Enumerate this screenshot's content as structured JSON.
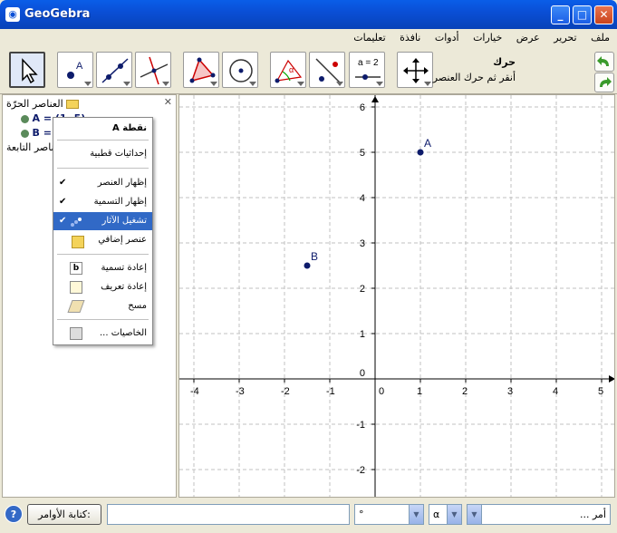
{
  "window": {
    "title": "GeoGebra",
    "minimize": "_",
    "maximize": "□",
    "close": "✕"
  },
  "menu": [
    "ملف",
    "تحرير",
    "عرض",
    "خيارات",
    "أدوات",
    "نافذة",
    "تعليمات"
  ],
  "toolbar": {
    "tool_name": "حرك",
    "tool_hint": "أنقر ثم حرك العنصر",
    "slider_label": "a = 2"
  },
  "algebra": {
    "free_folder": "العناصر الحرّة",
    "dependent_folder": "العناصر التابعة",
    "item_a": "A = (1, 5)",
    "item_b": "B = (-1.5, 2.5)",
    "close": "✕"
  },
  "context_menu": {
    "title": "نقطة A",
    "items": [
      "إحداثيات قطبية",
      "إظهار العنصر",
      "إظهار التسمية",
      "تشغيل الآثار",
      "عنصر إضافي",
      "إعادة تسمية",
      "إعادة تعريف",
      "مسح",
      "الخاصيات ..."
    ]
  },
  "graph": {
    "x_ticks": [
      "-4",
      "-3",
      "-2",
      "-1",
      "0",
      "1",
      "2",
      "3",
      "4",
      "5"
    ],
    "y_ticks": [
      "-2",
      "-1",
      "0",
      "1",
      "2",
      "3",
      "4",
      "5",
      "6"
    ],
    "points": [
      {
        "name": "A",
        "x": 1,
        "y": 5
      },
      {
        "name": "B",
        "x": -1.5,
        "y": 2.5
      }
    ]
  },
  "bottom": {
    "help": "?",
    "input_button": "كتابة الأوامر:",
    "input_value": "",
    "symbol_value": "°",
    "greek_value": "α",
    "command_value": "أمر ..."
  },
  "colors": {
    "point": "#0d1b6b",
    "highlight": "#3169c6",
    "titlebar": "#0a4fd6"
  }
}
